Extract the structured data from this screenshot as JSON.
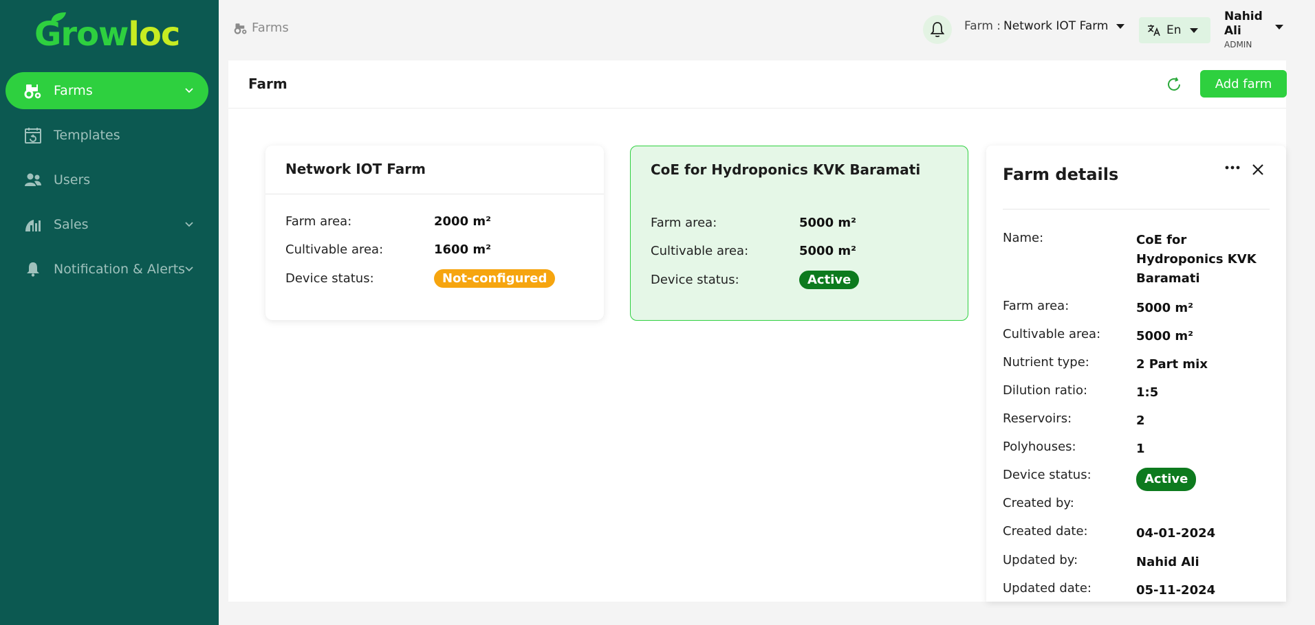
{
  "brand": {
    "part1": "Grow",
    "part2": "loc"
  },
  "colors": {
    "sidebar": "#0c5951",
    "accent": "#2ed03f",
    "warn": "#f6a50f",
    "ok": "#0d7a1e"
  },
  "sidebar": {
    "items": [
      {
        "label": "Farms",
        "icon": "tractor-icon"
      },
      {
        "label": "Templates",
        "icon": "template-icon"
      },
      {
        "label": "Users",
        "icon": "users-icon"
      },
      {
        "label": "Sales",
        "icon": "sales-chart-icon"
      },
      {
        "label": "Notification & Alerts",
        "icon": "bell-icon"
      }
    ]
  },
  "header": {
    "breadcrumb": "Farms",
    "farm_label": "Farm :",
    "farm_value": "Network IOT Farm",
    "language": "En",
    "user_name": "Nahid Ali",
    "user_role": "ADMIN"
  },
  "panel": {
    "title": "Farm",
    "add_button": "Add farm"
  },
  "cards": [
    {
      "name": "Network IOT Farm",
      "farm_area_label": "Farm area:",
      "farm_area": "2000 m²",
      "cultivable_label": "Cultivable area:",
      "cultivable": "1600 m²",
      "status_label": "Device status:",
      "status": "Not-configured"
    },
    {
      "name": "CoE for Hydroponics KVK Baramati",
      "farm_area_label": "Farm area:",
      "farm_area": "5000 m²",
      "cultivable_label": "Cultivable area:",
      "cultivable": "5000 m²",
      "status_label": "Device status:",
      "status": "Active"
    }
  ],
  "details": {
    "title": "Farm details",
    "rows": [
      {
        "label": "Name:",
        "value": "CoE for Hydroponics KVK Baramati"
      },
      {
        "label": "Farm area:",
        "value": "5000  m²"
      },
      {
        "label": "Cultivable area:",
        "value": "5000  m²"
      },
      {
        "label": "Nutrient type:",
        "value": "2 Part mix"
      },
      {
        "label": "Dilution ratio:",
        "value": "1:5"
      },
      {
        "label": "Reservoirs:",
        "value": "2"
      },
      {
        "label": "Polyhouses:",
        "value": "1"
      },
      {
        "label": "Device status:",
        "value": "Active"
      },
      {
        "label": "Created by:",
        "value": ""
      },
      {
        "label": "Created date:",
        "value": "04-01-2024"
      },
      {
        "label": "Updated by:",
        "value": "Nahid Ali"
      },
      {
        "label": "Updated date:",
        "value": "05-11-2024"
      }
    ]
  }
}
